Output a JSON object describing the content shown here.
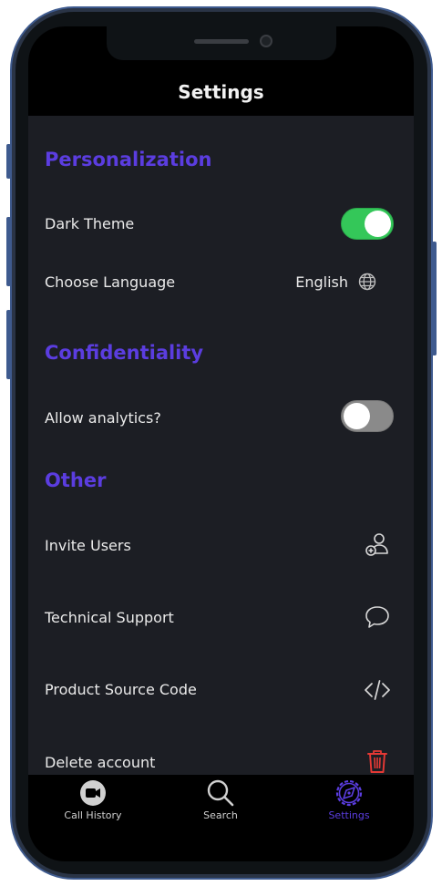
{
  "header": {
    "title": "Settings"
  },
  "sections": {
    "personalization": {
      "title": "Personalization",
      "dark_theme": {
        "label": "Dark Theme",
        "enabled": true
      },
      "language": {
        "label": "Choose Language",
        "value": "English",
        "icon": "globe-icon"
      }
    },
    "confidentiality": {
      "title": "Confidentiality",
      "analytics": {
        "label": "Allow analytics?",
        "enabled": false
      }
    },
    "other": {
      "title": "Other",
      "items": [
        {
          "label": "Invite Users",
          "icon": "add-user-icon"
        },
        {
          "label": "Technical Support",
          "icon": "chat-bubble-icon"
        },
        {
          "label": "Product Source Code",
          "icon": "code-icon"
        },
        {
          "label": "Delete account",
          "icon": "trash-icon"
        }
      ]
    }
  },
  "tabbar": {
    "tabs": [
      {
        "label": "Call History",
        "icon": "video-call-icon",
        "active": false
      },
      {
        "label": "Search",
        "icon": "search-icon",
        "active": false
      },
      {
        "label": "Settings",
        "icon": "gear-icon",
        "active": true
      }
    ]
  },
  "colors": {
    "accent": "#5b3de0",
    "toggle_on": "#34c759",
    "toggle_off": "#8a8a8a",
    "danger": "#e53935",
    "screen_bg": "#1c1e24",
    "frame": "#3e5a8e"
  }
}
